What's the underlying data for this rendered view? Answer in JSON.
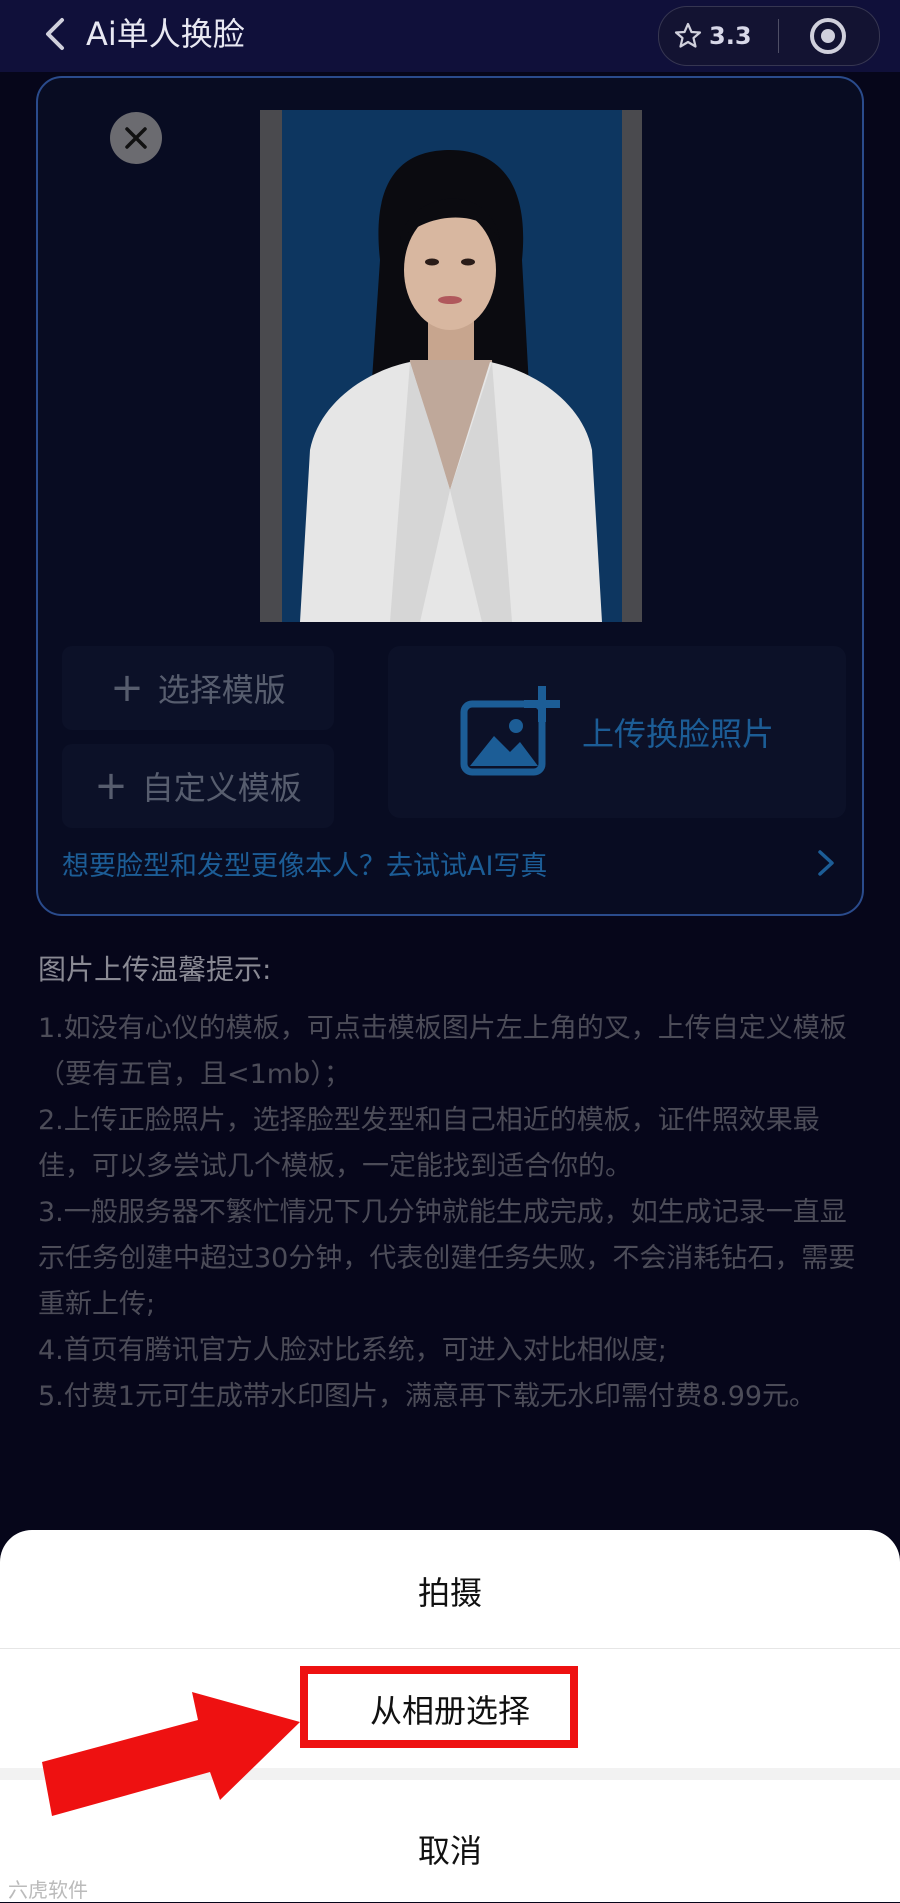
{
  "header": {
    "title": "Ai单人换脸",
    "rating": "3.3"
  },
  "card": {
    "select_template": "选择模版",
    "custom_template": "自定义模板",
    "upload_label": "上传换脸照片",
    "ai_link": "想要脸型和发型更像本人？去试试AI写真"
  },
  "tips": {
    "title": "图片上传温馨提示:",
    "items": [
      "1.如没有心仪的模板，可点击模板图片左上角的叉，上传自定义模板（要有五官，且<1mb）；",
      "2.上传正脸照片，选择脸型发型和自己相近的模板，证件照效果最佳，可以多尝试几个模板，一定能找到适合你的。",
      "3.一般服务器不繁忙情况下几分钟就能生成完成，如生成记录一直显示任务创建中超过30分钟，代表创建任务失败，不会消耗钻石，需要重新上传;",
      "4.首页有腾讯官方人脸对比系统，可进入对比相似度;",
      "5.付费1元可生成带水印图片，满意再下载无水印需付费8.99元。"
    ]
  },
  "sheet": {
    "take_photo": "拍摄",
    "choose_album": "从相册选择",
    "cancel": "取消"
  },
  "watermark": "六虎软件",
  "colors": {
    "accent_blue": "#1c5d96",
    "highlight_red": "#ee1111"
  }
}
